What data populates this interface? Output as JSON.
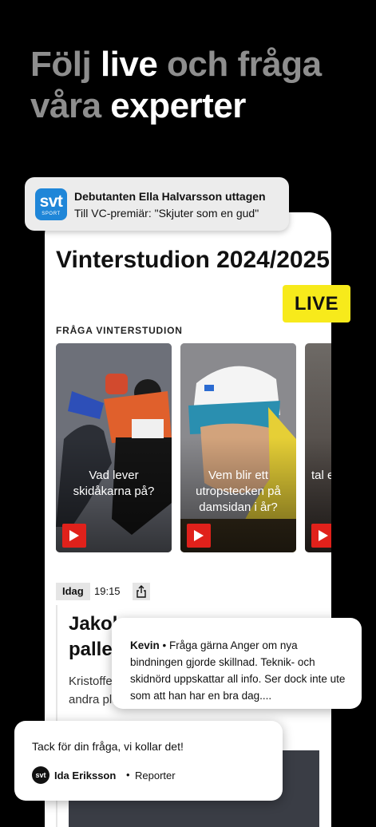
{
  "headline": {
    "part1": "Följ ",
    "part2": "live",
    "part3": " och fråga våra ",
    "part4": "experter"
  },
  "notification": {
    "app_icon_logo": "svt",
    "app_icon_sub": "SPORT",
    "title": "Debutanten Ella Halvarsson uttagen",
    "text": "Till VC-premiär: \"Skjuter som en gud\""
  },
  "studio": {
    "title": "Vinterstudion 2024/2025",
    "live_label": "LIVE",
    "section_label": "FRÅGA VINTERSTUDION",
    "cards": [
      {
        "text": "Vad lever skidåkarna på?"
      },
      {
        "text": "Vem blir ett utropstecken på damsidan i år?"
      },
      {
        "text": "tal end"
      }
    ]
  },
  "feed": {
    "day": "Idag",
    "time": "19:15",
    "article_title": "Jakob pallen",
    "article_body": "Kristoffer slalomtä åket räckte det ända till andra plats."
  },
  "question": {
    "author": "Kevin",
    "separator": " • ",
    "text": "Fråga gärna Anger om nya bindningen gjorde skillnad. Teknik- och skidnörd uppskattar all info. Ser dock inte ute som att han har en bra dag...."
  },
  "answer": {
    "text": "Tack för din fråga, vi kollar det!",
    "avatar": "svt",
    "name": "Ida Eriksson",
    "separator": "•",
    "role": "Reporter"
  },
  "colors": {
    "background": "#000000",
    "headline_dim": "#8e8e8e",
    "live_yellow": "#f7ea1b",
    "play_red": "#e0211b",
    "svt_blue": "#1f86d8"
  }
}
